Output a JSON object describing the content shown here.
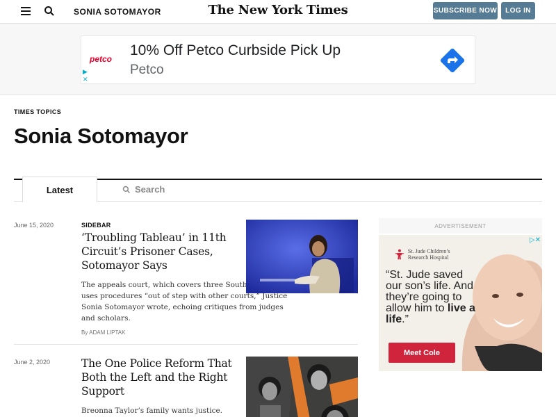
{
  "header": {
    "section": "SONIA SOTOMAYOR",
    "masthead": "The New York Times",
    "subscribe_label": "SUBSCRIBE NOW",
    "login_label": "LOG IN"
  },
  "top_ad": {
    "logo": "petco",
    "headline": "10% Off Petco Curbside Pick Up",
    "brand": "Petco",
    "arrow_color": "#1a73e8"
  },
  "topic": {
    "kicker": "TIMES TOPICS",
    "title": "Sonia Sotomayor"
  },
  "tabs": {
    "latest": "Latest",
    "search": "Search"
  },
  "articles": [
    {
      "date": "June 15, 2020",
      "label": "SIDEBAR",
      "headline": "‘Troubling Tableau’ in 11th Circuit’s Prisoner Cases, Sotomayor Says",
      "summary": "The appeals court, which covers three Southern states, uses procedures “out of step with other courts,” Justice Sonia Sotomayor wrote, echoing critiques from judges and scholars.",
      "byline": "By ADAM LIPTAK"
    },
    {
      "date": "June 2, 2020",
      "label": "",
      "headline": "The One Police Reform That Both the Left and the Right Support",
      "summary": "Breonna Taylor’s family wants justice.",
      "byline": ""
    }
  ],
  "side_ad": {
    "label": "ADVERTISEMENT",
    "org": "St. Jude Children’s Research Hospital",
    "quote_1": "“St. Jude saved our son’s life. And they’re going to allow him to ",
    "quote_bold": "live a life",
    "quote_2": ".”",
    "button": "Meet Cole",
    "brand_color": "#d0233c"
  }
}
